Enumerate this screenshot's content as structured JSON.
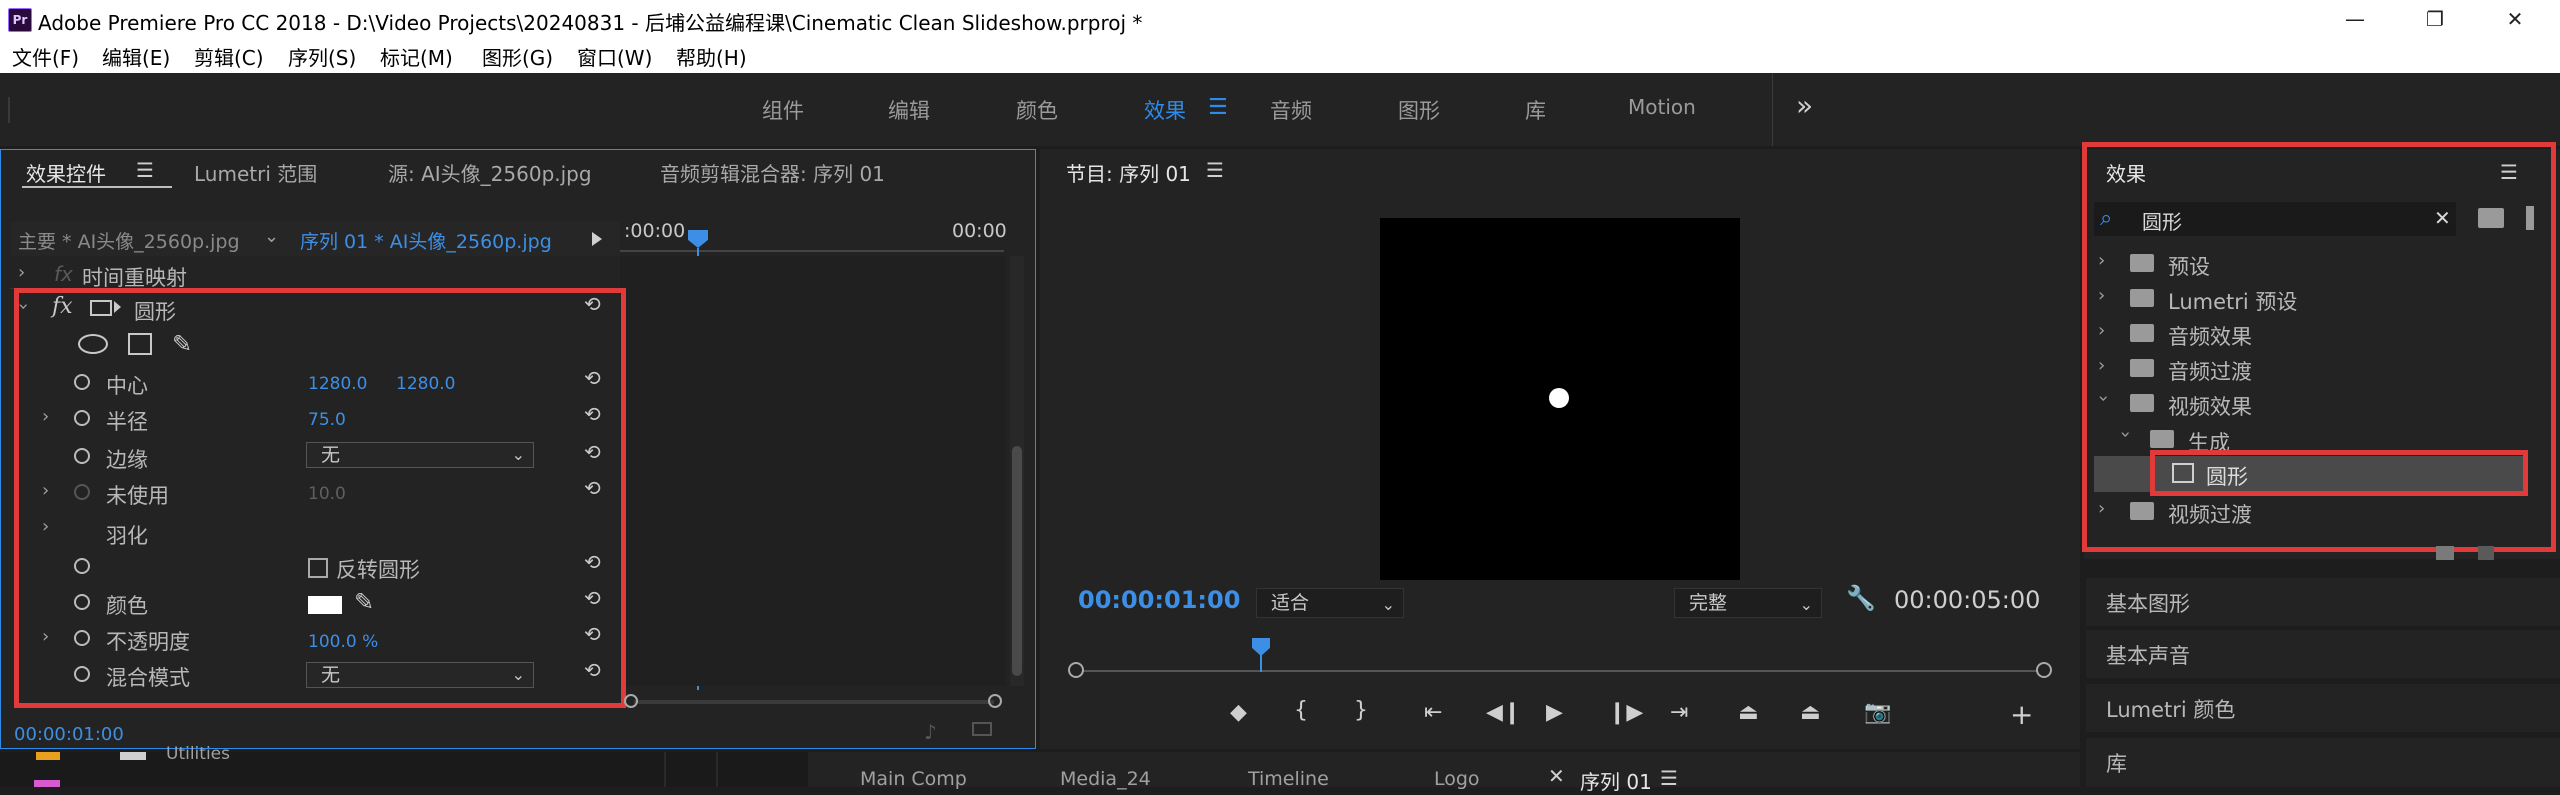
{
  "window": {
    "title": "Adobe Premiere Pro CC 2018 - D:\\Video Projects\\20240831 - 后埔公益编程课\\Cinematic Clean Slideshow.prproj *",
    "app_icon": "Pr",
    "controls": {
      "minimize": "—",
      "restore": "❐",
      "close": "✕"
    }
  },
  "menu": [
    "文件(F)",
    "编辑(E)",
    "剪辑(C)",
    "序列(S)",
    "标记(M)",
    "图形(G)",
    "窗口(W)",
    "帮助(H)"
  ],
  "workspaces": {
    "tabs": [
      "组件",
      "编辑",
      "颜色",
      "效果",
      "音频",
      "图形",
      "库",
      "Motion"
    ],
    "active": "效果",
    "overflow": "»"
  },
  "effect_controls": {
    "tabs": [
      "效果控件",
      "Lumetri 范围",
      "源: AI头像_2560p.jpg",
      "音频剪辑混合器: 序列 01"
    ],
    "master_clip": "主要 * AI头像_2560p.jpg",
    "sequence_clip": "序列 01 * AI头像_2560p.jpg",
    "ruler_start": ":00:00",
    "ruler_end": "00:00",
    "time_remap": "时间重映射",
    "effect_name": "圆形",
    "fx": "fx",
    "props": {
      "center": {
        "label": "中心",
        "x": "1280.0",
        "y": "1280.0"
      },
      "radius": {
        "label": "半径",
        "value": "75.0"
      },
      "edge": {
        "label": "边缘",
        "value": "无"
      },
      "unused": {
        "label": "未使用",
        "value": "10.0"
      },
      "feather": {
        "label": "羽化"
      },
      "invert": {
        "label": "反转圆形"
      },
      "color": {
        "label": "颜色",
        "swatch": "#ffffff"
      },
      "opacity": {
        "label": "不透明度",
        "value": "100.0 %"
      },
      "blend": {
        "label": "混合模式",
        "value": "无"
      }
    },
    "timecode": "00:00:01:00"
  },
  "program_monitor": {
    "title": "节目: 序列 01",
    "current_time": "00:00:01:00",
    "fit": "适合",
    "quality": "完整",
    "duration": "00:00:05:00"
  },
  "effects_panel": {
    "title": "效果",
    "search_value": "圆形",
    "tree": [
      {
        "label": "预设",
        "expanded": false
      },
      {
        "label": "Lumetri 预设",
        "expanded": false
      },
      {
        "label": "音频效果",
        "expanded": false
      },
      {
        "label": "音频过渡",
        "expanded": false
      },
      {
        "label": "视频效果",
        "expanded": true
      },
      {
        "label": "生成",
        "expanded": true
      },
      {
        "label": "圆形",
        "selected": true
      },
      {
        "label": "视频过渡",
        "expanded": false
      }
    ]
  },
  "side_panels": [
    "基本图形",
    "基本声音",
    "Lumetri 颜色",
    "库"
  ],
  "bottom_tabs": [
    "Utilities",
    "Main Comp",
    "Media_24",
    "Timeline",
    "Logo",
    "序列 01"
  ],
  "colors": {
    "accent": "#2d8ceb",
    "highlight_box": "#e03a3a",
    "panel_bg": "#232323"
  }
}
